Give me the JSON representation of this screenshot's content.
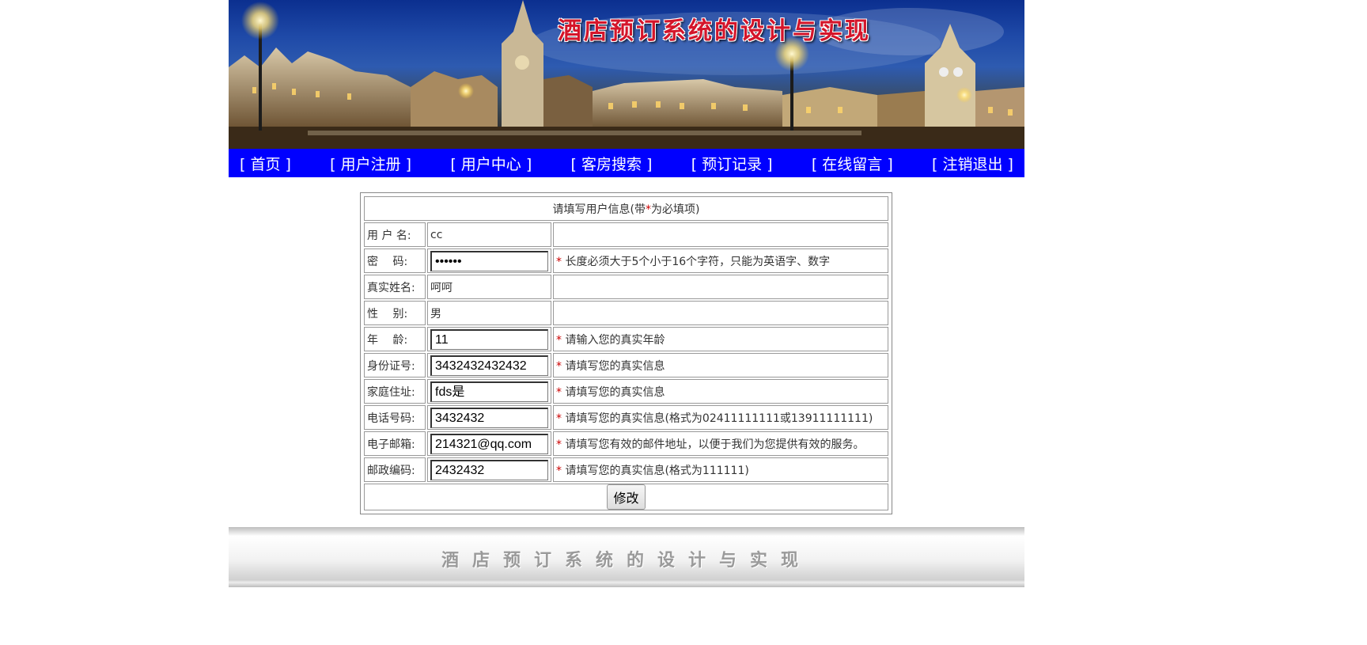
{
  "banner": {
    "title": "酒店预订系统的设计与实现"
  },
  "nav": [
    {
      "label": "[ 首页 ]"
    },
    {
      "label": "[ 用户注册 ]"
    },
    {
      "label": "[ 用户中心 ]"
    },
    {
      "label": "[ 客房搜索 ]"
    },
    {
      "label": "[ 预订记录 ]"
    },
    {
      "label": "[ 在线留言 ]"
    },
    {
      "label": "[ 注销退出 ]"
    }
  ],
  "form": {
    "header_prefix": "请填写用户信息(带",
    "header_star": "*",
    "header_suffix": "为必填项)",
    "rows": [
      {
        "label": "用 户 名:",
        "value": "cc",
        "hint": ""
      },
      {
        "label": "密　 码:",
        "value": "••••••",
        "hint": "长度必须大于5个小于16个字符，只能为英语字、数字"
      },
      {
        "label": "真实姓名:",
        "value": "呵呵",
        "hint": ""
      },
      {
        "label": "性　 别:",
        "value": "男",
        "hint": ""
      },
      {
        "label": "年　 龄:",
        "value": "11",
        "hint": "请输入您的真实年龄"
      },
      {
        "label": "身份证号:",
        "value": "3432432432432",
        "hint": "请填写您的真实信息"
      },
      {
        "label": "家庭住址:",
        "value": "fds是",
        "hint": "请填写您的真实信息"
      },
      {
        "label": "电话号码:",
        "value": "3432432",
        "hint": "请填写您的真实信息(格式为02411111111或13911111111)"
      },
      {
        "label": "电子邮箱:",
        "value": "214321@qq.com",
        "hint": "请填写您有效的邮件地址，以便于我们为您提供有效的服务。"
      },
      {
        "label": "邮政编码:",
        "value": "2432432",
        "hint": "请填写您的真实信息(格式为111111)"
      }
    ],
    "star": "*",
    "submit_label": "修改"
  },
  "footer": {
    "text": "酒店预订系统的设计与实现"
  },
  "colors": {
    "nav_bg": "#0000ff",
    "title_red": "#d4152a",
    "label_brown": "#8a5a3a",
    "star_red": "#cc0000"
  }
}
